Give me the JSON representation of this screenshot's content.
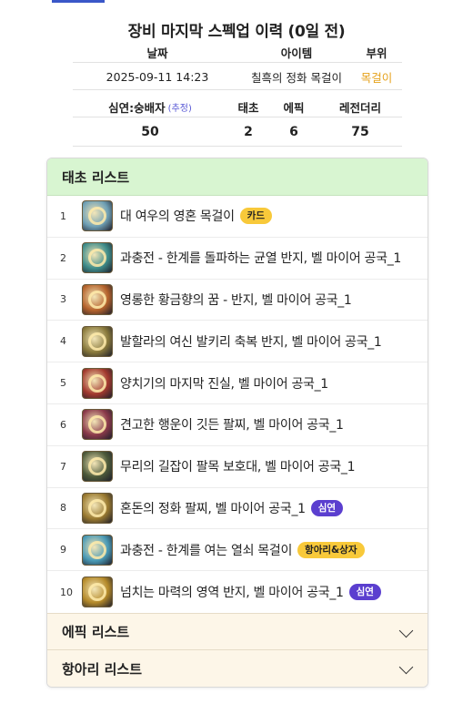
{
  "header": {
    "title": "장비 마지막 스펙업 이력 (0일 전)"
  },
  "summary": {
    "col_date": "날짜",
    "col_item": "아이템",
    "col_slot": "부위",
    "date": "2025-09-11 14:23",
    "item": "칠흑의 정화 목걸이",
    "slot": "목걸이",
    "col_source": "심연:숭배자",
    "source_note": "(추정)",
    "col_taecho": "태초",
    "col_epic": "에픽",
    "col_legendary": "레전더리",
    "source_value": "50",
    "taecho_value": "2",
    "epic_value": "6",
    "legendary_value": "75"
  },
  "taecho_list": {
    "title": "태초 리스트",
    "items": [
      {
        "index": "1",
        "name": "대 여우의 영혼 목걸이",
        "badge": "카드",
        "badge_color": "#f8c93a",
        "icon_color": "#6fa0b5"
      },
      {
        "index": "2",
        "name": "과충전 - 한계를 돌파하는 균열 반지, 벨 마이어 공국_1",
        "badge": "",
        "icon_color": "#3f8d8a"
      },
      {
        "index": "3",
        "name": "영롱한 황금향의 꿈 - 반지, 벨 마이어 공국_1",
        "badge": "",
        "icon_color": "#b5632c"
      },
      {
        "index": "4",
        "name": "발할라의 여신 발키리 축복 반지, 벨 마이어 공국_1",
        "badge": "",
        "icon_color": "#8a7a3c"
      },
      {
        "index": "5",
        "name": "양치기의 마지막 진실, 벨 마이어 공국_1",
        "badge": "",
        "icon_color": "#a33a2e"
      },
      {
        "index": "6",
        "name": "견고한 행운이 깃든 팔찌, 벨 마이어 공국_1",
        "badge": "",
        "icon_color": "#8b3a4a"
      },
      {
        "index": "7",
        "name": "무리의 길잡이 팔목 보호대, 벨 마이어 공국_1",
        "badge": "",
        "icon_color": "#4d5a3a"
      },
      {
        "index": "8",
        "name": "혼돈의 정화 팔찌, 벨 마이어 공국_1",
        "badge": "심연",
        "badge_color": "#5b3fcf",
        "icon_color": "#9a7a30"
      },
      {
        "index": "9",
        "name": "과충전 - 한계를 여는 열쇠 목걸이",
        "badge": "항아리&상자",
        "badge_color": "#f8c93a",
        "icon_color": "#4a9ab5"
      },
      {
        "index": "10",
        "name": "넘치는 마력의 영역 반지, 벨 마이어 공국_1",
        "badge": "심연",
        "badge_color": "#5b3fcf",
        "icon_color": "#b58a2a"
      }
    ]
  },
  "epic_list": {
    "title": "에픽 리스트"
  },
  "hangari_list": {
    "title": "항아리 리스트"
  }
}
